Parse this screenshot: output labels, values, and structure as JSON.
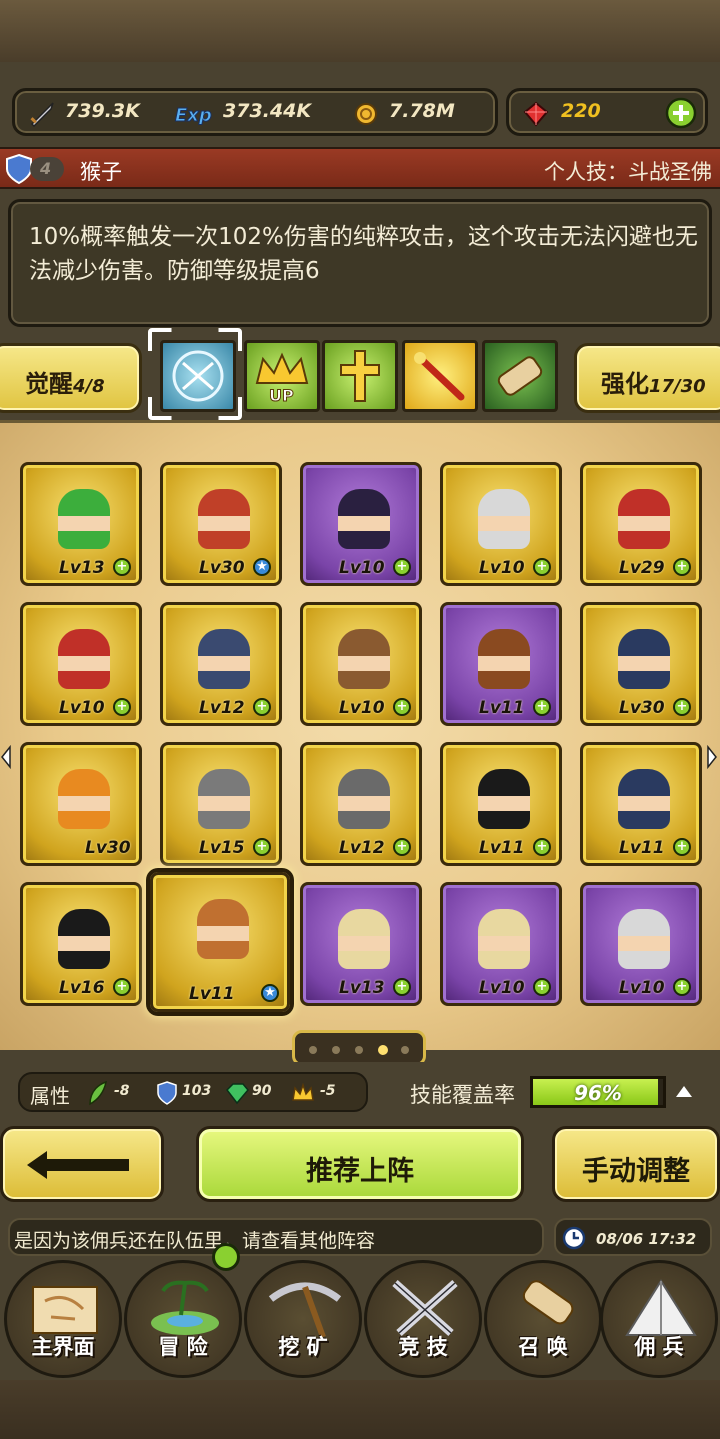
{
  "resources": {
    "attack_value": "739.3K",
    "exp_value": "373.44K",
    "gold_value": "7.78M",
    "gem_value": "220",
    "icons": [
      "sword-icon",
      "exp-icon",
      "coin-icon",
      "ruby-icon",
      "add-icon"
    ]
  },
  "hero": {
    "rank": "4",
    "name": "猴子",
    "skill_title": "个人技：斗战圣佛",
    "description": "10%概率触发一次102%伤害的纯粹攻击，这个攻击无法闪避也无法减少伤害。防御等级提高6"
  },
  "awaken": {
    "label": "觉醒",
    "value": "4/8"
  },
  "enhance": {
    "label": "强化",
    "value": "17/30"
  },
  "tabs": [
    "skill-orb-icon",
    "crown-up-icon",
    "cross-handshake-icon",
    "staff-icon",
    "scroll-icon"
  ],
  "cards": [
    {
      "level": "Lv13",
      "rarity": "gold",
      "badge": "plus",
      "hair": "#3cae3c"
    },
    {
      "level": "Lv30",
      "rarity": "gold",
      "badge": "star",
      "hair": "#c04028"
    },
    {
      "level": "Lv10",
      "rarity": "purple",
      "badge": "plus",
      "hair": "#2a2040"
    },
    {
      "level": "Lv10",
      "rarity": "gold",
      "badge": "plus",
      "hair": "#d8d8d8"
    },
    {
      "level": "Lv29",
      "rarity": "gold",
      "badge": "plus",
      "hair": "#c03028"
    },
    {
      "level": "Lv10",
      "rarity": "gold",
      "badge": "plus",
      "hair": "#c03028"
    },
    {
      "level": "Lv12",
      "rarity": "gold",
      "badge": "plus",
      "hair": "#3a4a70"
    },
    {
      "level": "Lv10",
      "rarity": "gold",
      "badge": "plus",
      "hair": "#8a5a30"
    },
    {
      "level": "Lv11",
      "rarity": "purple",
      "badge": "plus",
      "hair": "#8a4a20"
    },
    {
      "level": "Lv30",
      "rarity": "gold",
      "badge": "plus",
      "hair": "#2a3a60"
    },
    {
      "level": "Lv30",
      "rarity": "gold",
      "badge": "none",
      "hair": "#e88a20"
    },
    {
      "level": "Lv15",
      "rarity": "gold",
      "badge": "plus",
      "hair": "#7a7a7a"
    },
    {
      "level": "Lv12",
      "rarity": "gold",
      "badge": "plus",
      "hair": "#6a6a6a"
    },
    {
      "level": "Lv11",
      "rarity": "gold",
      "badge": "plus",
      "hair": "#1a1a1a"
    },
    {
      "level": "Lv11",
      "rarity": "gold",
      "badge": "plus",
      "hair": "#2a3a60"
    },
    {
      "level": "Lv16",
      "rarity": "gold",
      "badge": "plus",
      "hair": "#1a1a1a"
    },
    {
      "level": "Lv11",
      "rarity": "gold",
      "badge": "star",
      "hair": "#c07030",
      "selected": true
    },
    {
      "level": "Lv13",
      "rarity": "purple",
      "badge": "plus",
      "hair": "#e8d8a0"
    },
    {
      "level": "Lv10",
      "rarity": "purple",
      "badge": "plus",
      "hair": "#e8d8a0"
    },
    {
      "level": "Lv10",
      "rarity": "purple",
      "badge": "plus",
      "hair": "#d8d8d8"
    }
  ],
  "pager": {
    "pages": 5,
    "current": 4
  },
  "stats": {
    "label": "属性",
    "attack": "-8",
    "defense": "103",
    "speed": "90",
    "crown": "-5"
  },
  "coverage": {
    "label": "技能覆盖率",
    "value": "96%",
    "fraction": 0.96
  },
  "buttons": {
    "recommend": "推荐上阵",
    "manual": "手动调整"
  },
  "message": "是因为该佣兵还在队伍里，请查看其他阵容",
  "time": "08/06 17:32",
  "nav": [
    "主界面",
    "冒 险",
    "挖 矿",
    "竞 技",
    "召 唤",
    "佣 兵"
  ],
  "colors": {
    "accent_green": "#a8d838",
    "gold": "#f0c020",
    "name_bar": "#8a3220"
  }
}
